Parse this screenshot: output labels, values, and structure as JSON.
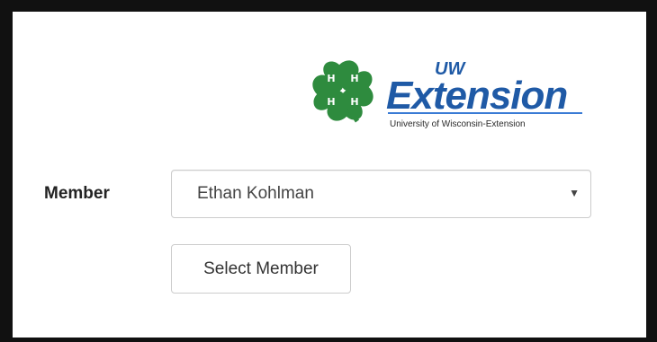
{
  "logo": {
    "brand_top": "UW",
    "brand_main": "Extension",
    "subtitle": "University of Wisconsin-Extension",
    "clover_letters": [
      "H",
      "H",
      "H",
      "H"
    ],
    "colors": {
      "clover": "#2e8b3e",
      "brand": "#1f5aa6",
      "swoosh": "#3a7bd5"
    }
  },
  "form": {
    "member_label": "Member",
    "member_selected": "Ethan Kohlman",
    "select_button_label": "Select Member"
  },
  "icons": {
    "dropdown": "triangle-down-icon"
  }
}
